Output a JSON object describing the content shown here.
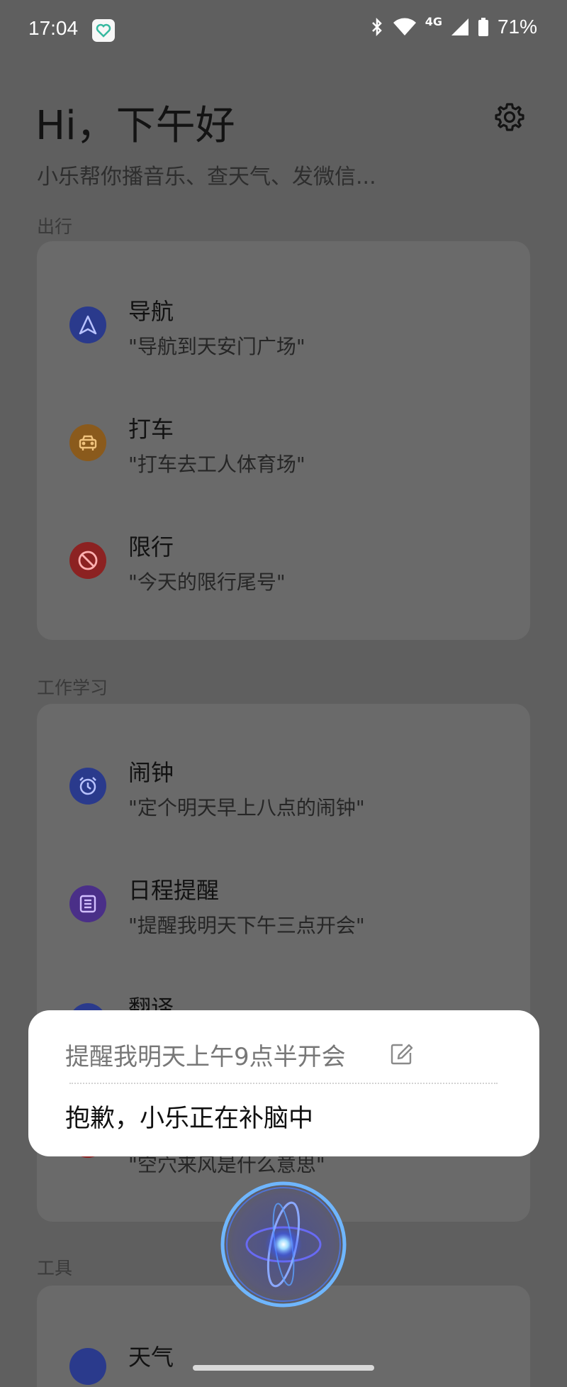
{
  "status_bar": {
    "time": "17:04",
    "network": "4G",
    "battery": "71%"
  },
  "header": {
    "greeting": "Hi，下午好",
    "subtitle": "小乐帮你播音乐、查天气、发微信..."
  },
  "sections": [
    {
      "label": "出行",
      "items": [
        {
          "title": "导航",
          "example": "\"导航到天安门广场\"",
          "icon": "navigation-icon",
          "color": "#2a3a8c"
        },
        {
          "title": "打车",
          "example": "\"打车去工人体育场\"",
          "icon": "taxi-icon",
          "color": "#8a5a1c"
        },
        {
          "title": "限行",
          "example": "\"今天的限行尾号\"",
          "icon": "no-entry-icon",
          "color": "#8c2222"
        }
      ]
    },
    {
      "label": "工作学习",
      "items": [
        {
          "title": "闹钟",
          "example": "\"定个明天早上八点的闹钟\"",
          "icon": "alarm-clock-icon",
          "color": "#2a3a8c"
        },
        {
          "title": "日程提醒",
          "example": "\"提醒我明天下午三点开会\"",
          "icon": "schedule-list-icon",
          "color": "#4a2f88"
        },
        {
          "title": "翻译",
          "example": "",
          "icon": "translate-icon",
          "color": "#2a3a8c"
        },
        {
          "title": "",
          "example": "\"空穴来风是什么意思\"",
          "icon": "idiom-icon",
          "color": "#8c2222"
        }
      ]
    },
    {
      "label": "工具",
      "items": [
        {
          "title": "天气",
          "example": "",
          "icon": "weather-icon",
          "color": "#2a3a8c"
        }
      ]
    }
  ],
  "popup": {
    "query": "提醒我明天上午9点半开会",
    "answer": "抱歉，小乐正在补脑中"
  }
}
